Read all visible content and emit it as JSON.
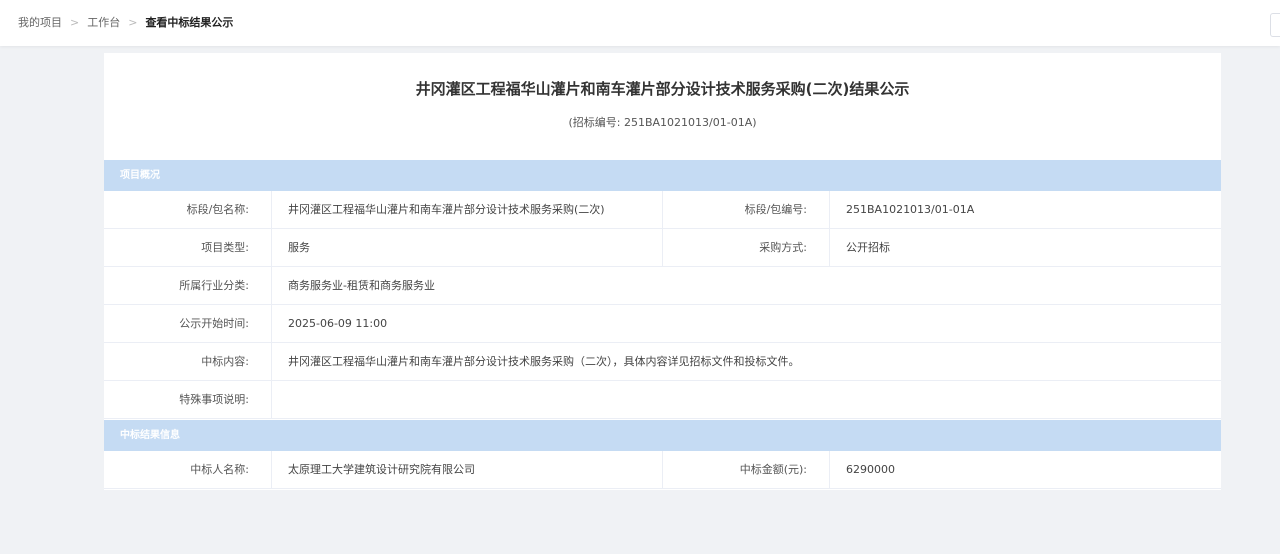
{
  "breadcrumb": {
    "items": [
      "我的项目",
      "工作台",
      "查看中标结果公示"
    ]
  },
  "header": {
    "title": "井冈灌区工程福华山灌片和南车灌片部分设计技术服务采购(二次)结果公示",
    "subtitle": "(招标编号: 251BA1021013/01-01A)"
  },
  "sections": {
    "overview": "项目概况",
    "result": "中标结果信息"
  },
  "overview": {
    "package_name_label": "标段/包名称:",
    "package_name_value": "井冈灌区工程福华山灌片和南车灌片部分设计技术服务采购(二次)",
    "package_no_label": "标段/包编号:",
    "package_no_value": "251BA1021013/01-01A",
    "project_type_label": "项目类型:",
    "project_type_value": "服务",
    "procurement_label": "采购方式:",
    "procurement_value": "公开招标",
    "industry_label": "所属行业分类:",
    "industry_value": "商务服务业-租赁和商务服务业",
    "start_time_label": "公示开始时间:",
    "start_time_value": "2025-06-09 11:00",
    "content_label": "中标内容:",
    "content_value": "井冈灌区工程福华山灌片和南车灌片部分设计技术服务采购（二次），具体内容详见招标文件和投标文件。",
    "special_label": "特殊事项说明:",
    "special_value": ""
  },
  "result": {
    "winner_label": "中标人名称:",
    "winner_value": "太原理工大学建筑设计研究院有限公司",
    "amount_label": "中标金额(元):",
    "amount_value": "6290000"
  }
}
